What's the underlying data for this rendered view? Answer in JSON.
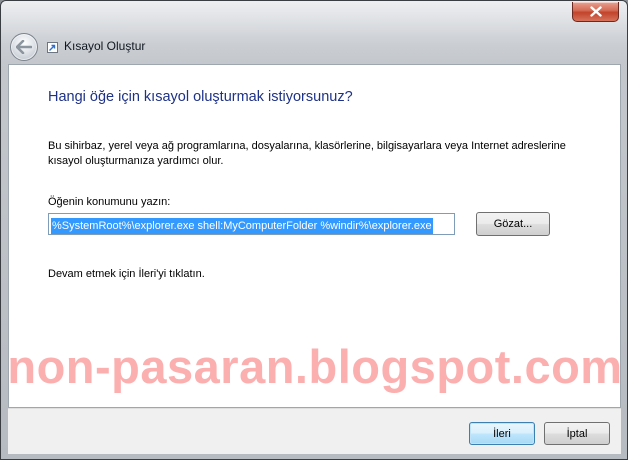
{
  "window": {
    "title": "Kısayol Oluştur"
  },
  "wizard": {
    "heading": "Hangi öğe için kısayol oluşturmak istiyorsunuz?",
    "description": "Bu sihirbaz, yerel veya ağ programlarına, dosyalarına, klasörlerine, bilgisayarlara veya Internet adreslerine kısayol oluşturmanıza yardımcı olur.",
    "location_label": "Öğenin konumunu yazın:",
    "location_value": "%SystemRoot%\\explorer.exe shell:MyComputerFolder %windir%\\explorer.exe",
    "browse_label": "Gözat...",
    "continue_hint": "Devam etmek için İleri'yi tıklatın."
  },
  "footer": {
    "next_label": "İleri",
    "cancel_label": "İptal"
  },
  "watermark": "non-pasaran.blogspot.com",
  "icons": {
    "back": "back-arrow-icon",
    "close": "close-icon",
    "app": "shortcut-icon"
  },
  "colors": {
    "heading": "#1e3287",
    "selection": "#3399ff",
    "close_button": "#c2432a",
    "watermark": "#f76e6e"
  }
}
